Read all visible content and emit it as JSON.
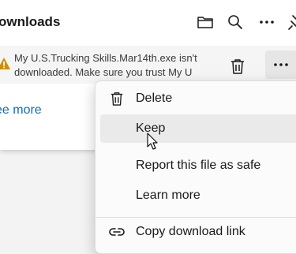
{
  "header": {
    "title": "ownloads"
  },
  "download": {
    "line1": "My U.S.Trucking Skills.Mar14th.exe isn't",
    "line2": "downloaded. Make sure you trust My U"
  },
  "see_more": "ee more",
  "menu": {
    "items": [
      {
        "label": "Delete",
        "icon": "trash-icon"
      },
      {
        "label": "Keep",
        "icon": ""
      },
      {
        "label": "Report this file as safe",
        "icon": ""
      },
      {
        "label": "Learn more",
        "icon": ""
      },
      {
        "label": "Copy download link",
        "icon": "link-icon"
      }
    ],
    "hovered": "Keep"
  },
  "colors": {
    "link": "#0f6cbd",
    "warning": "#d18e00",
    "hover": "#eaeaea"
  }
}
